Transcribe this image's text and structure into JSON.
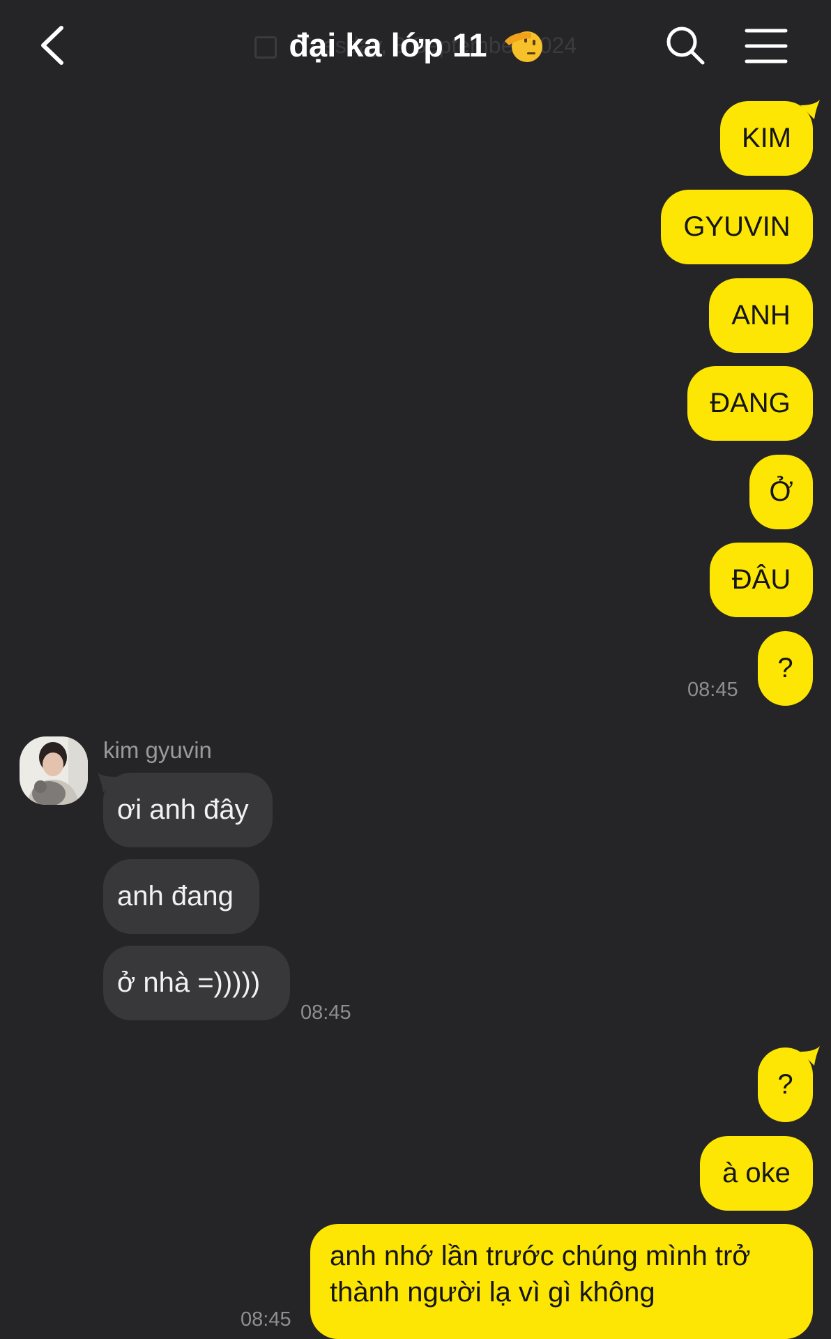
{
  "header": {
    "title": "đại ka lớp 11",
    "date_ghost": "Tuesday, 3 September 2024",
    "emoji": "saluting-face"
  },
  "messages_outgoing_1": [
    "KIM",
    "GYUVIN",
    "ANH",
    "ĐANG",
    "Ở",
    "ĐÂU",
    "?"
  ],
  "time_1": "08:45",
  "incoming": {
    "sender": "kim gyuvin",
    "messages": [
      "ơi anh đây",
      "anh đang",
      "ở nhà =)))))"
    ],
    "time": "08:45"
  },
  "messages_outgoing_2": [
    "?",
    "à oke"
  ],
  "long_message": [
    "anh nhớ lần trước chúng mình trở",
    "thành người lạ vì gì không"
  ],
  "time_3": "08:45",
  "colors": {
    "background": "#252527",
    "outgoing": "#fde603",
    "incoming": "#38383b"
  }
}
